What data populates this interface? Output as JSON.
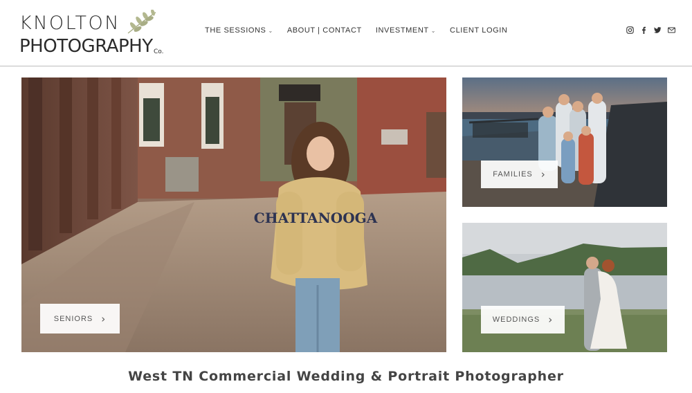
{
  "brand": {
    "line1": "KNOLTON",
    "line2": "PHOTOGRAPHY",
    "suffix": "Co."
  },
  "nav": [
    {
      "label": "THE SESSIONS",
      "has_dropdown": true
    },
    {
      "label": "ABOUT | CONTACT",
      "has_dropdown": false
    },
    {
      "label": "INVESTMENT",
      "has_dropdown": true
    },
    {
      "label": "CLIENT LOGIN",
      "has_dropdown": false
    }
  ],
  "social_icons": [
    "instagram-icon",
    "facebook-icon",
    "twitter-icon",
    "email-icon"
  ],
  "cards": {
    "seniors": {
      "label": "SENIORS",
      "photo_text": "CHATTANOOGA"
    },
    "families": {
      "label": "FAMILIES"
    },
    "weddings": {
      "label": "WEDDINGS"
    }
  },
  "arrow_glyph": "›",
  "tagline": "West TN Commercial Wedding & Portrait Photographer",
  "colors": {
    "header_border": "#bdbdbd",
    "text": "#333333",
    "leaf": "#a8ad85"
  }
}
